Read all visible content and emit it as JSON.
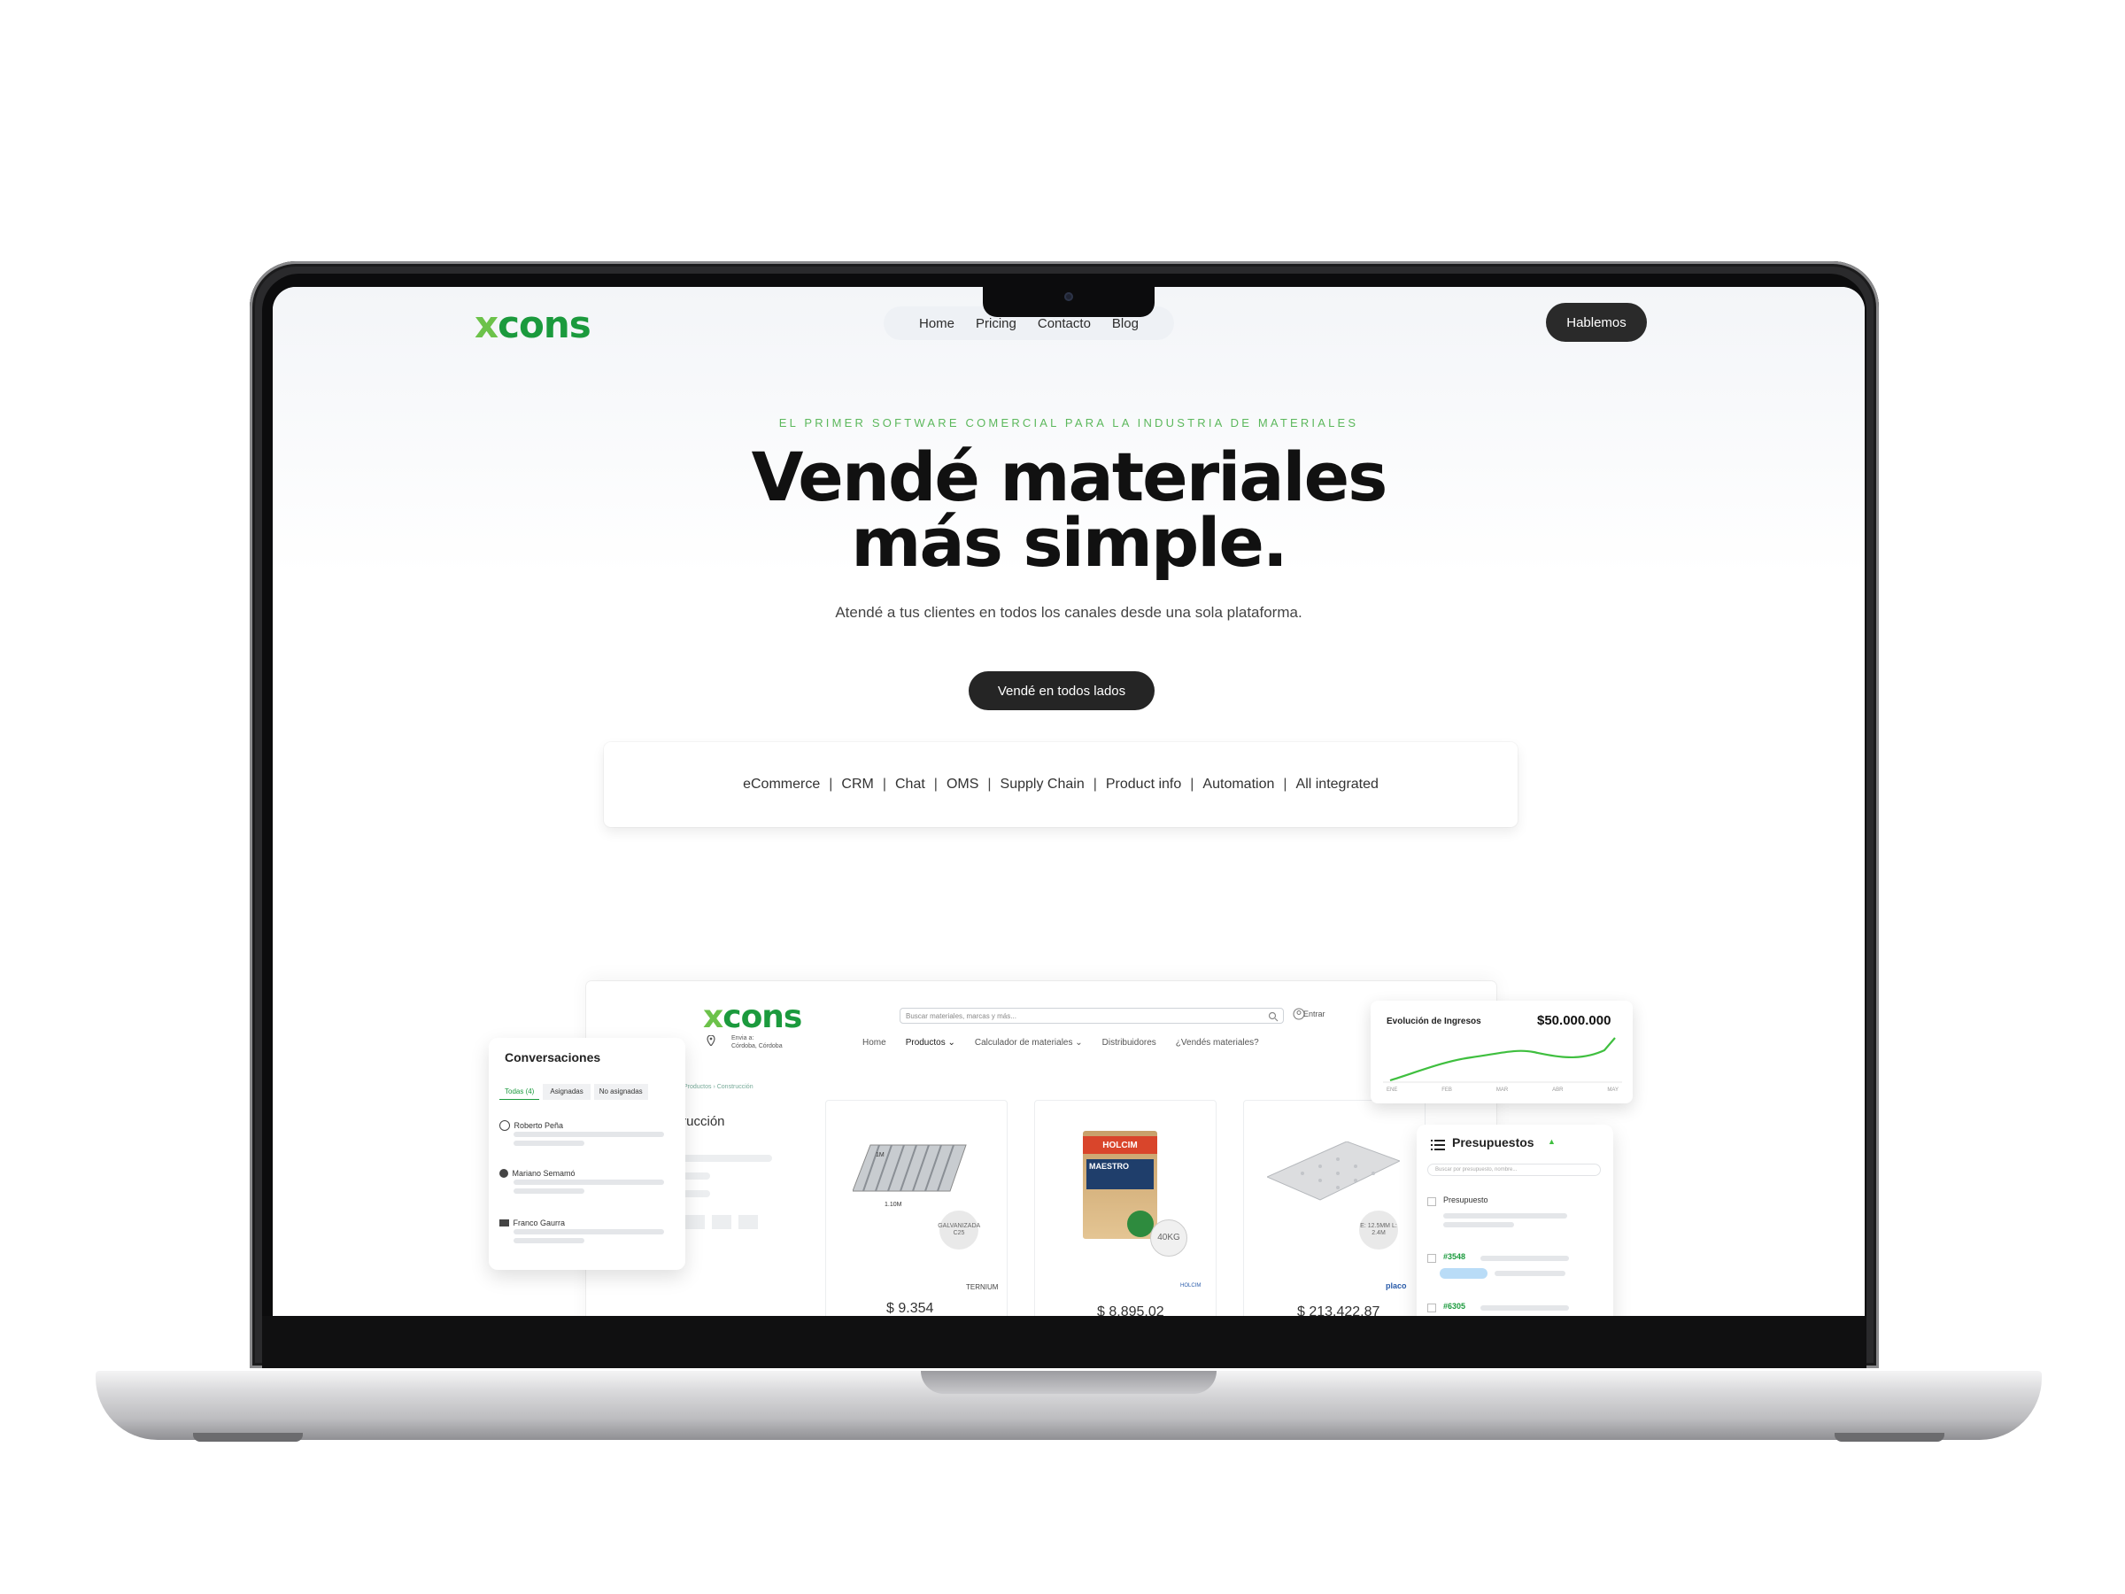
{
  "site": {
    "logo": "xcons",
    "nav": [
      "Home",
      "Pricing",
      "Contacto",
      "Blog"
    ],
    "cta_top": "Hablemos",
    "eyebrow": "EL PRIMER SOFTWARE COMERCIAL PARA LA INDUSTRIA DE MATERIALES",
    "headline_1": "Vendé materiales",
    "headline_2": "más simple.",
    "subtitle": "Atendé a tus clientes en todos los canales desde una sola plataforma.",
    "cta_main": "Vendé en todos lados",
    "features": [
      "eCommerce",
      "CRM",
      "Chat",
      "OMS",
      "Supply Chain",
      "Product info",
      "Automation",
      "All integrated"
    ],
    "feature_separator": "|"
  },
  "mockup": {
    "logo": "xcons",
    "location_line1": "Envia a:",
    "location_line2": "Córdoba, Córdoba",
    "search_placeholder": "Buscar materiales, marcas y más...",
    "login": "Entrar",
    "nav": [
      "Home",
      "Productos ⌄",
      "Calculador de materiales ⌄",
      "Distribuidores",
      "¿Vendés materiales?"
    ],
    "breadcrumb": "Productos  ›  Construcción",
    "category": "trucción",
    "products": [
      {
        "price": "$ 9.354",
        "brand": "TERNIUM",
        "badge": "GALVANIZADA C25",
        "label_a": "1M",
        "label_b": "1.10M"
      },
      {
        "price": "$ 8.895,02",
        "brand": "HOLCIM",
        "badge": "40KG",
        "label_a": "HOLCIM",
        "label_b": "MAESTRO"
      },
      {
        "price": "$ 213.422,87",
        "brand": "placo",
        "badge": "E: 12.5MM L: 2.4M",
        "label_a": "",
        "label_b": ""
      }
    ]
  },
  "conversations": {
    "title": "Conversaciones",
    "tabs": [
      "Todas (4)",
      "Asignadas",
      "No asignadas"
    ],
    "items": [
      {
        "name": "Roberto Peña",
        "icon": "whatsapp-icon"
      },
      {
        "name": "Mariano Semamó",
        "icon": "facebook-icon"
      },
      {
        "name": "Franco Gaurra",
        "icon": "mail-icon"
      }
    ]
  },
  "income_chart": {
    "title": "Evolución de Ingresos",
    "total": "$50.000.000",
    "months": [
      "ENE",
      "FEB",
      "MAR",
      "ABR",
      "MAY"
    ]
  },
  "budgets": {
    "title": "Presupuestos",
    "search_placeholder": "Buscar por presupuesto, nombre...",
    "column": "Presupuesto",
    "rows": [
      "#3548",
      "#6305"
    ]
  },
  "colors": {
    "brand_green": "#1b9a3d",
    "brand_light_green": "#6cc24a",
    "dark_button": "#252525"
  }
}
